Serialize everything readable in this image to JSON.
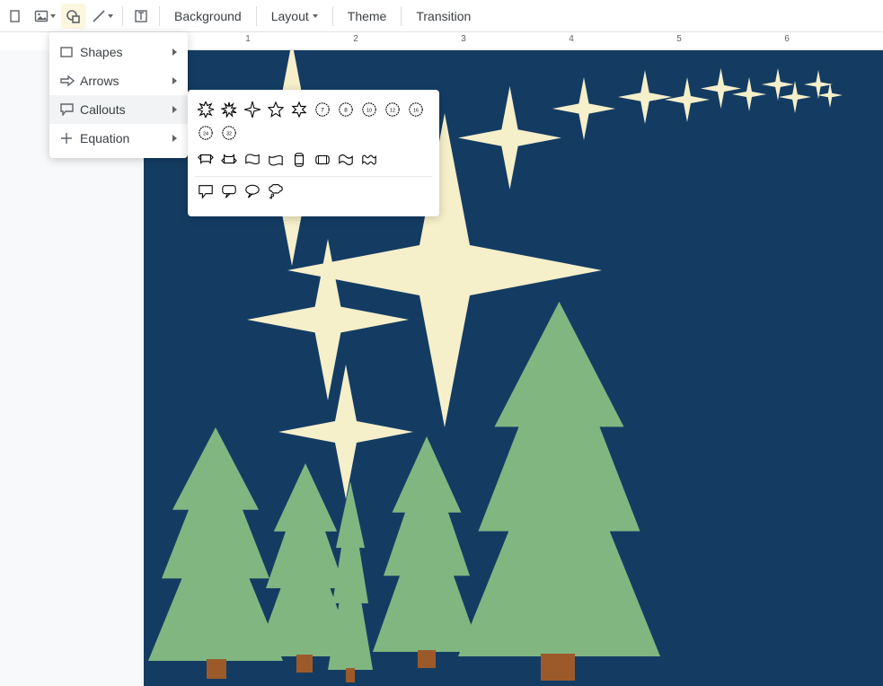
{
  "toolbar": {
    "select_tool_title": "Select",
    "image_tool_title": "Image",
    "shape_tool_title": "Shape",
    "line_tool_title": "Line",
    "textbox_tool_title": "Text box",
    "background_label": "Background",
    "layout_label": "Layout",
    "theme_label": "Theme",
    "transition_label": "Transition"
  },
  "shape_menu": {
    "items": [
      {
        "id": "shapes",
        "label": "Shapes"
      },
      {
        "id": "arrows",
        "label": "Arrows"
      },
      {
        "id": "callouts",
        "label": "Callouts"
      },
      {
        "id": "equation",
        "label": "Equation"
      }
    ],
    "hovered": "callouts"
  },
  "callouts_submenu": {
    "row1": [
      "explosion1",
      "explosion2",
      "star4",
      "star5",
      "star6",
      "star7",
      "star8",
      "star10",
      "star12",
      "star16",
      "star24",
      "star32"
    ],
    "row2": [
      "ribbon-up",
      "ribbon-down",
      "ribbon2-up",
      "ribbon2-down",
      "scroll-vert",
      "scroll-horz",
      "wave",
      "double-wave"
    ],
    "row3": [
      "speech-rect",
      "speech-round",
      "speech-oval",
      "speech-cloud"
    ]
  },
  "ruler": {
    "labels": [
      "1",
      "2",
      "3",
      "4",
      "5",
      "6"
    ]
  },
  "colors": {
    "slide_bg": "#143c63",
    "tree_fill": "#81b681",
    "trunk_fill": "#9c5a2b",
    "star_fill": "#f5efca"
  }
}
